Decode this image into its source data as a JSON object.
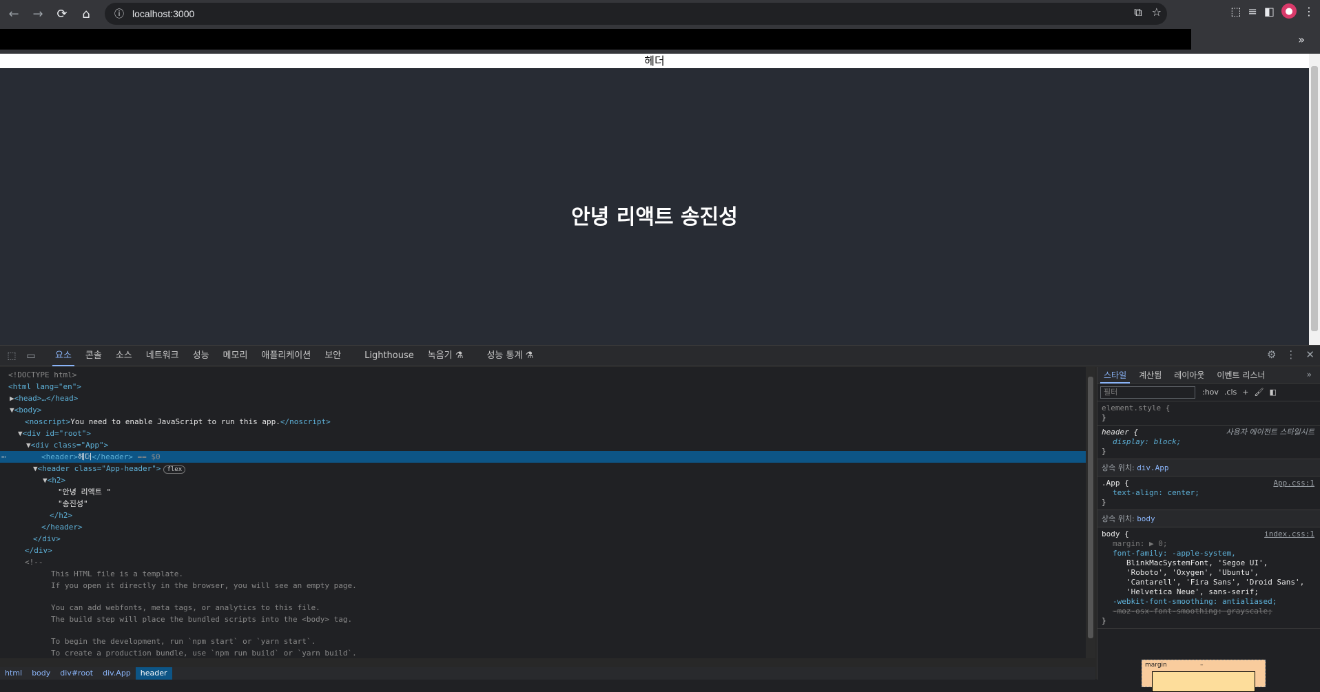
{
  "browser": {
    "url": "localhost:3000",
    "nav": {
      "back": "←",
      "forward": "→",
      "reload": "⟳",
      "home": "⌂"
    },
    "avatar_initial": "●"
  },
  "page": {
    "header_text": "헤더",
    "heading": "안녕 리액트 송진성",
    "bg_color": "#282c34"
  },
  "devtools": {
    "tabs": [
      "요소",
      "콘솔",
      "소스",
      "네트워크",
      "성능",
      "메모리",
      "애플리케이션",
      "보안",
      "Lighthouse",
      "녹음기 ⚗",
      "성능 통계 ⚗"
    ],
    "dom": {
      "doctype": "<!DOCTYPE html>",
      "html_open": "<html lang=\"en\">",
      "head": "<head>…</head>",
      "body_open": "<body>",
      "noscript_text": "You need to enable JavaScript to run this app.",
      "root_open": "<div id=\"root\">",
      "app_open": "<div class=\"App\">",
      "header_sel_text": "헤더",
      "header_sel_suffix": " == $0",
      "app_header_open": "<header class=\"App-header\">",
      "flex_badge": "flex",
      "h2_open": "<h2>",
      "text1": "\"안녕 리액트 \"",
      "text2": "\"송진성\"",
      "h2_close": "</h2>",
      "header_close": "</header>",
      "div_close": "</div>",
      "root_close": "</div>",
      "comment_open": "<!--",
      "comment_lines": [
        "This HTML file is a template.",
        "If you open it directly in the browser, you will see an empty page.",
        "",
        "You can add webfonts, meta tags, or analytics to this file.",
        "The build step will place the bundled scripts into the <body> tag.",
        "",
        "To begin the development, run `npm start` or `yarn start`.",
        "To create a production bundle, use `npm run build` or `yarn build`."
      ]
    },
    "breadcrumbs": [
      "html",
      "body",
      "div#root",
      "div.App",
      "header"
    ],
    "styles_tabs": [
      "스타일",
      "계산됨",
      "레이아웃",
      "이벤트 리스너"
    ],
    "filter_placeholder": "필터",
    "filter_opts": [
      ":hov",
      ".cls",
      "+"
    ],
    "rules": {
      "element_style": "element.style {",
      "header_sel": "header {",
      "header_src": "사용자 에이전트 스타일시트",
      "header_prop": "display: block;",
      "inherit_app_label": "상속 위치: ",
      "inherit_app_target": "div.App",
      "app_sel": ".App {",
      "app_src": "App.css:1",
      "app_prop": "text-align: center;",
      "inherit_body_label": "상속 위치: ",
      "inherit_body_target": "body",
      "body_sel": "body {",
      "body_src": "index.css:1",
      "body_margin": "margin: ▶ 0;",
      "body_font_family": "font-family: -apple-system,",
      "font_lines": [
        "BlinkMacSystemFont, 'Segoe UI',",
        "'Roboto', 'Oxygen', 'Ubuntu',",
        "'Cantarell', 'Fira Sans', 'Droid Sans',",
        "'Helvetica Neue', sans-serif;"
      ],
      "webkit_smoothing": "-webkit-font-smoothing: antialiased;",
      "moz_smoothing": "-moz-osx-font-smoothing: grayscale;",
      "close": "}"
    },
    "boxmodel_label": "margin",
    "boxmodel_dash": "–"
  }
}
